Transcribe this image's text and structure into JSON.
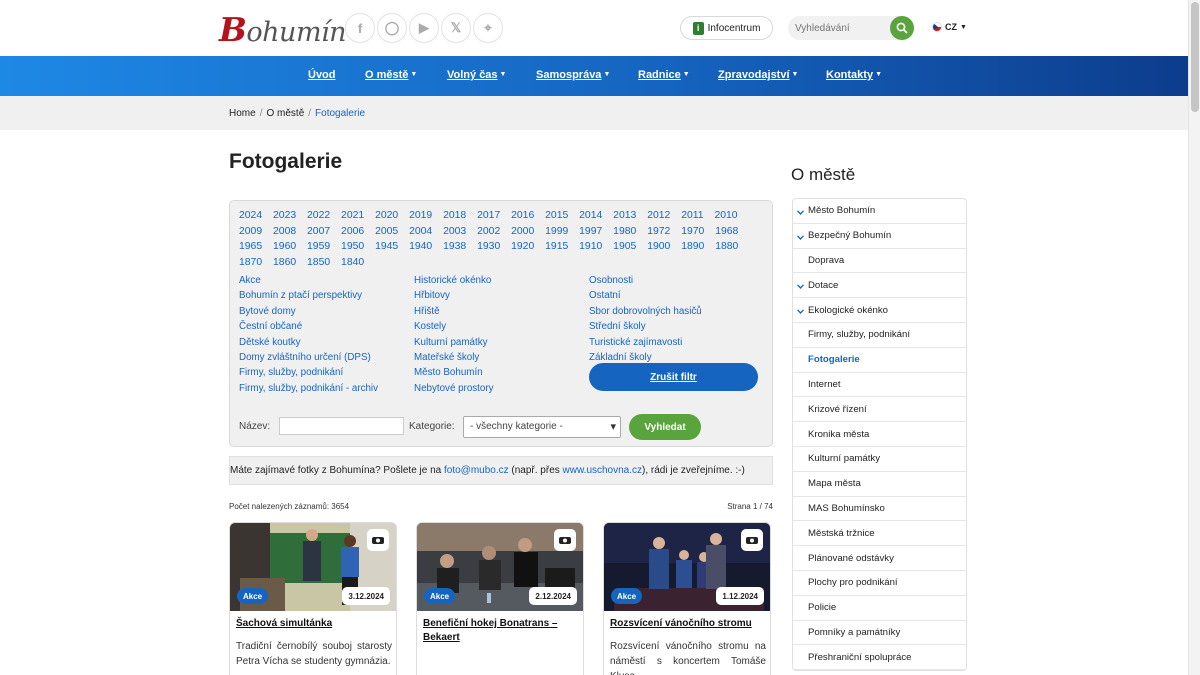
{
  "header": {
    "logo_text": "Bohumín",
    "social_icons": [
      "facebook-icon",
      "instagram-icon",
      "youtube-icon",
      "x-icon",
      "rss-icon"
    ],
    "infocentrum_label": "Infocentrum",
    "search_placeholder": "Vyhledávání",
    "language": "CZ"
  },
  "nav": {
    "items": [
      {
        "label": "Úvod"
      },
      {
        "label": "O městě"
      },
      {
        "label": "Volný čas"
      },
      {
        "label": "Samospráva"
      },
      {
        "label": "Radnice"
      },
      {
        "label": "Zpravodajství"
      },
      {
        "label": "Kontakty"
      }
    ]
  },
  "breadcrumb": {
    "home": "Home",
    "section": "O městě",
    "current": "Fotogalerie"
  },
  "page": {
    "title": "Fotogalerie"
  },
  "filter": {
    "years": [
      "2024",
      "2023",
      "2022",
      "2021",
      "2020",
      "2019",
      "2018",
      "2017",
      "2016",
      "2015",
      "2014",
      "2013",
      "2012",
      "2011",
      "2010",
      "2009",
      "2008",
      "2007",
      "2006",
      "2005",
      "2004",
      "2003",
      "2002",
      "2000",
      "1999",
      "1997",
      "1980",
      "1972",
      "1970",
      "1968",
      "1965",
      "1960",
      "1959",
      "1950",
      "1945",
      "1940",
      "1938",
      "1930",
      "1920",
      "1915",
      "1910",
      "1905",
      "1900",
      "1890",
      "1880",
      "1870",
      "1860",
      "1850",
      "1840"
    ],
    "categories_col1": [
      "Akce",
      "Bohumín z ptačí perspektivy",
      "Bytové domy",
      "Čestní občané",
      "Dětské koutky",
      "Domy zvláštního určení (DPS)",
      "Firmy, služby, podnikání",
      "Firmy, služby, podnikání - archiv"
    ],
    "categories_col2": [
      "Historické okénko",
      "Hřbitovy",
      "Hřiště",
      "Kostely",
      "Kulturní památky",
      "Mateřské školy",
      "Město Bohumín",
      "Nebytové prostory"
    ],
    "categories_col3": [
      "Osobnosti",
      "Ostatní",
      "Sbor dobrovolných hasičů",
      "Střední školy",
      "Turistické zajímavosti",
      "Základní školy"
    ],
    "cancel_label": "Zrušit filtr",
    "name_label": "Název:",
    "category_label": "Kategorie:",
    "category_selected": "- všechny kategorie -",
    "search_label": "Vyhledat"
  },
  "notice": {
    "text_before": "Máte zajímavé fotky z Bohumína? Pošlete je na ",
    "email": "foto@mubo.cz",
    "text_middle": " (např. přes ",
    "link": "www.uschovna.cz",
    "text_after": "), rádi je zveřejníme. :-)"
  },
  "results": {
    "count_text": "Počet nalezených záznamů: 3654",
    "page_text": "Strana 1 / 74"
  },
  "cards": [
    {
      "badge": "Akce",
      "date": "3.12.2024",
      "title": "Šachová simultánka",
      "description": "Tradiční černobílý souboj starosty Petra Vícha se studenty gymnázia."
    },
    {
      "badge": "Akce",
      "date": "2.12.2024",
      "title": "Benefiční hokej Bonatrans – Bekaert",
      "description": ""
    },
    {
      "badge": "Akce",
      "date": "1.12.2024",
      "title": "Rozsvícení vánočního stromu",
      "description": "Rozsvícení vánočního stromu na náměstí s koncertem Tomáše Klusa."
    }
  ],
  "sidebar": {
    "title": "O městě",
    "items": [
      {
        "label": "Město Bohumín",
        "chevron": true
      },
      {
        "label": "Bezpečný Bohumín",
        "chevron": true
      },
      {
        "label": "Doprava",
        "chevron": false
      },
      {
        "label": "Dotace",
        "chevron": true
      },
      {
        "label": "Ekologické okénko",
        "chevron": true
      },
      {
        "label": "Firmy, služby, podnikání",
        "chevron": false
      },
      {
        "label": "Fotogalerie",
        "chevron": false,
        "active": true
      },
      {
        "label": "Internet",
        "chevron": false
      },
      {
        "label": "Krizové řízení",
        "chevron": false
      },
      {
        "label": "Kronika města",
        "chevron": false
      },
      {
        "label": "Kulturní památky",
        "chevron": false
      },
      {
        "label": "Mapa města",
        "chevron": false
      },
      {
        "label": "MAS Bohumínsko",
        "chevron": false
      },
      {
        "label": "Městská tržnice",
        "chevron": false
      },
      {
        "label": "Plánované odstávky",
        "chevron": false
      },
      {
        "label": "Plochy pro podnikání",
        "chevron": false
      },
      {
        "label": "Policie",
        "chevron": false
      },
      {
        "label": "Pomníky a památníky",
        "chevron": false
      },
      {
        "label": "Přeshraniční spolupráce",
        "chevron": false
      }
    ]
  },
  "colors": {
    "primary": "#1565c0",
    "green": "#5aa43d",
    "brand_red": "#b5121b"
  }
}
